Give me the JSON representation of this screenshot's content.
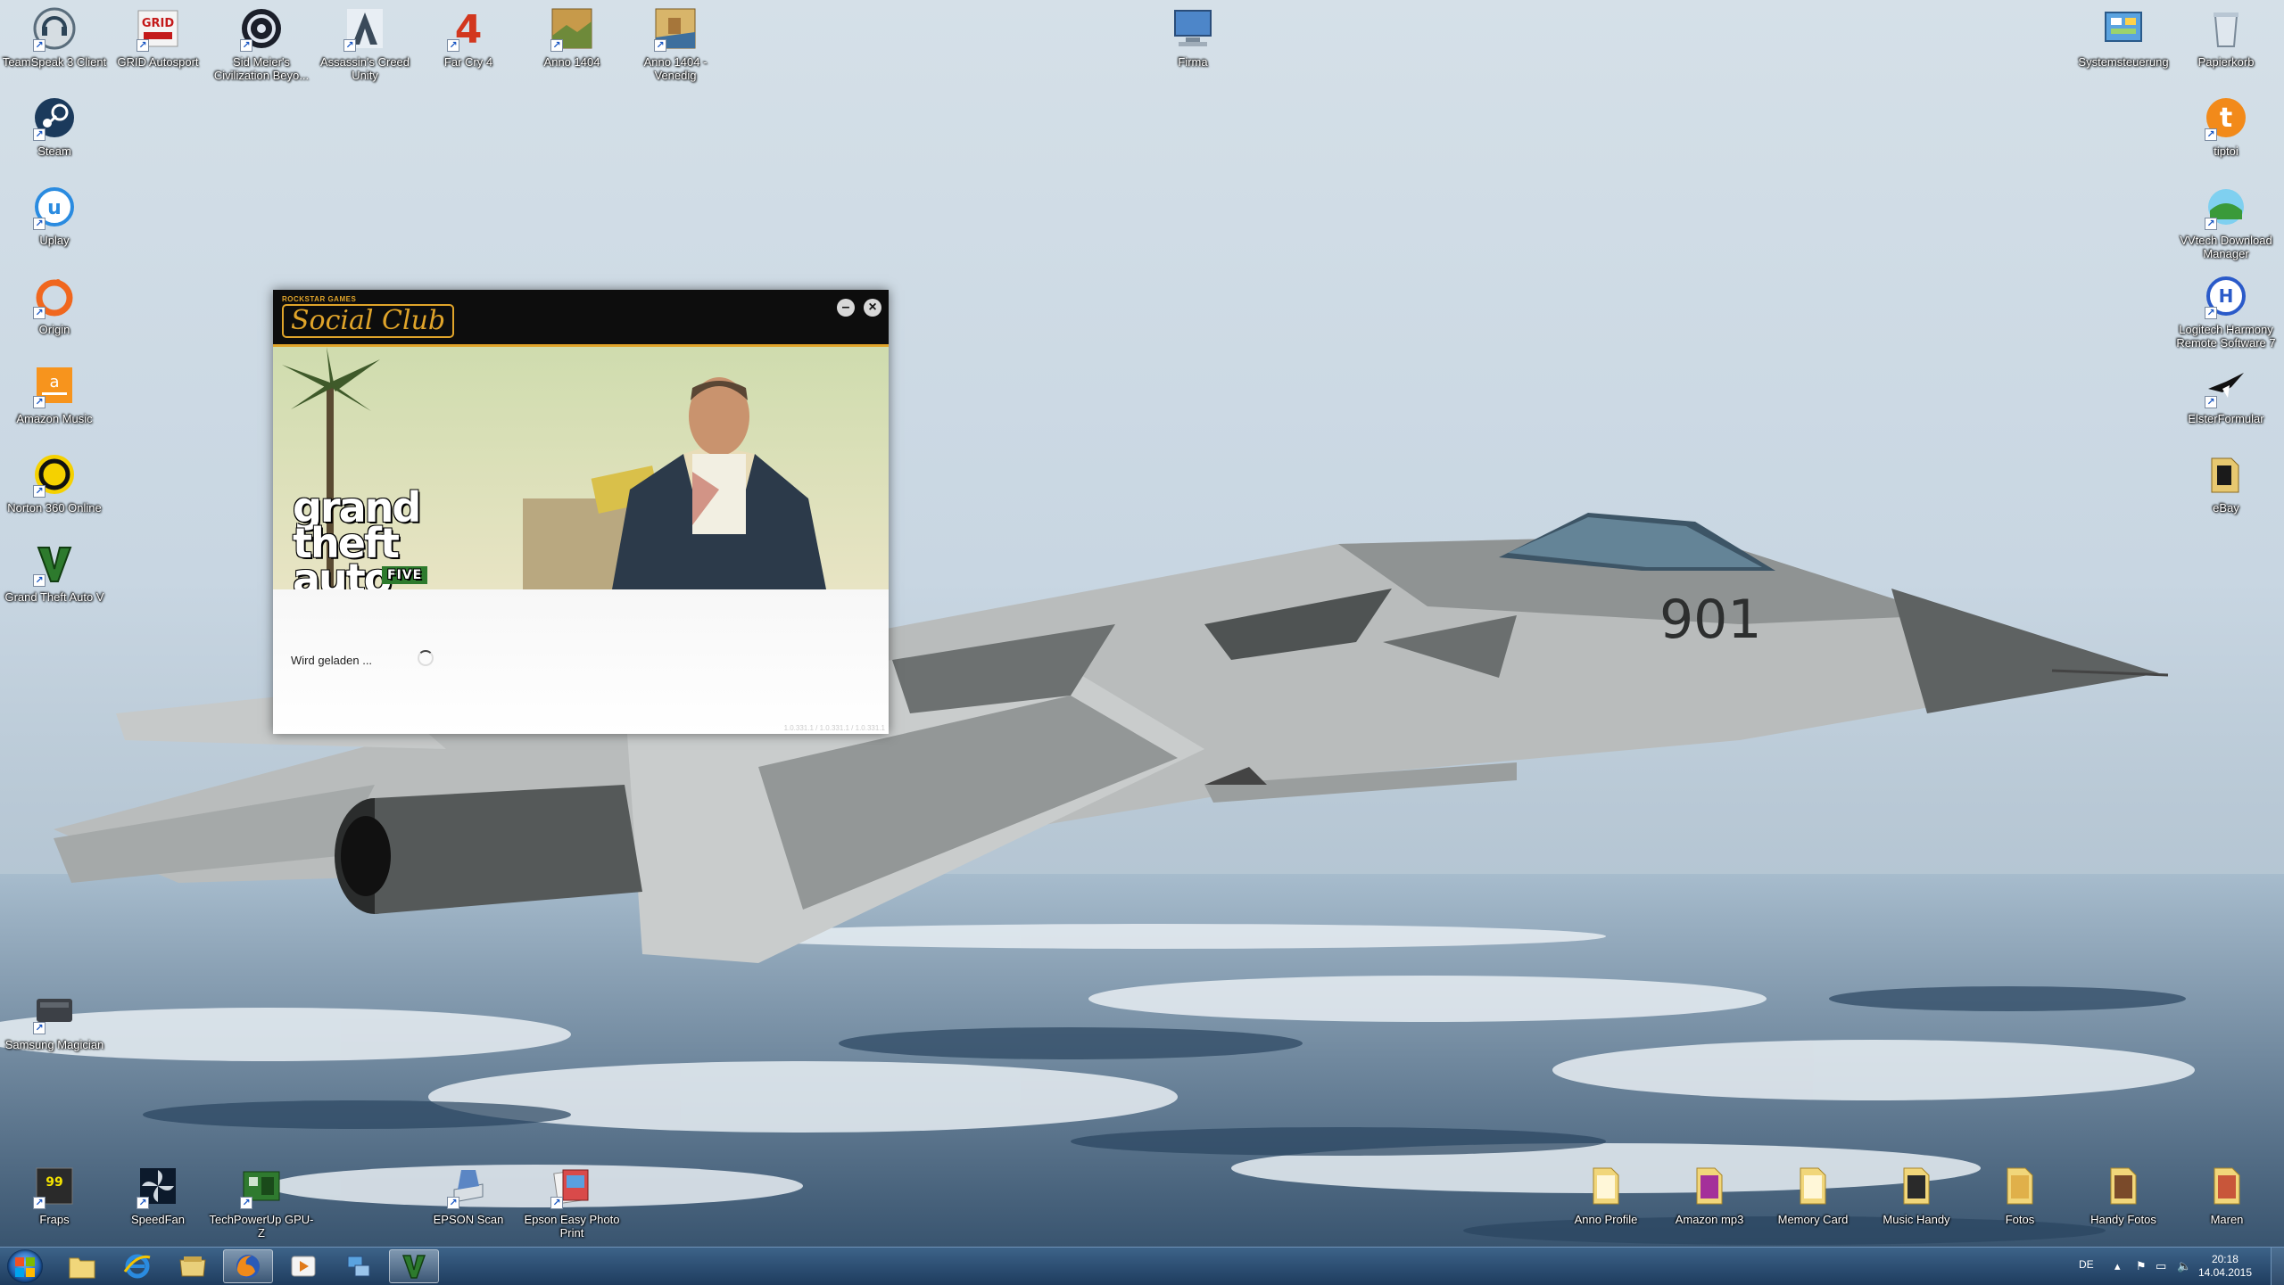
{
  "desktop": {
    "top_row": [
      {
        "label": "TeamSpeak 3 Client",
        "icon": "teamspeak-icon"
      },
      {
        "label": "GRID Autosport",
        "icon": "grid-autosport-icon"
      },
      {
        "label": "Sid Meier's Civilization Beyo...",
        "icon": "civilization-icon"
      },
      {
        "label": "Assassin's Creed Unity",
        "icon": "assassins-creed-icon"
      },
      {
        "label": "Far Cry 4",
        "icon": "far-cry-4-icon"
      },
      {
        "label": "Anno 1404",
        "icon": "anno-1404-icon"
      },
      {
        "label": "Anno 1404 - Venedig",
        "icon": "anno-1404-venedig-icon"
      },
      {
        "label": "Firma",
        "icon": "computer-icon"
      }
    ],
    "left_column": [
      {
        "label": "Steam",
        "icon": "steam-icon"
      },
      {
        "label": "Uplay",
        "icon": "uplay-icon"
      },
      {
        "label": "Origin",
        "icon": "origin-icon"
      },
      {
        "label": "Amazon Music",
        "icon": "amazon-music-icon"
      },
      {
        "label": "Norton 360 Online",
        "icon": "norton-icon"
      },
      {
        "label": "Grand Theft Auto V",
        "icon": "gta-v-icon"
      },
      {
        "label": "Samsung Magician",
        "icon": "samsung-magician-icon"
      }
    ],
    "right_column": [
      {
        "label": "Systemsteuerung",
        "icon": "control-panel-icon"
      },
      {
        "label": "Papierkorb",
        "icon": "recycle-bin-icon"
      },
      {
        "label": "tiptoi",
        "icon": "tiptoi-icon"
      },
      {
        "label": "VVtech Download Manager",
        "icon": "download-manager-icon"
      },
      {
        "label": "Logitech Harmony Remote Software 7",
        "icon": "logitech-harmony-icon"
      },
      {
        "label": "ElsterFormular",
        "icon": "elster-icon"
      },
      {
        "label": "eBay",
        "icon": "ebay-folder-icon"
      }
    ],
    "bottom_left": [
      {
        "label": "Fraps",
        "icon": "fraps-icon"
      },
      {
        "label": "SpeedFan",
        "icon": "speedfan-icon"
      },
      {
        "label": "TechPowerUp GPU-Z",
        "icon": "gpu-z-icon"
      },
      {
        "label": "EPSON Scan",
        "icon": "epson-scan-icon"
      },
      {
        "label": "Epson Easy Photo Print",
        "icon": "epson-photo-icon"
      }
    ],
    "bottom_right": [
      {
        "label": "Anno Profile",
        "icon": "folder-icon"
      },
      {
        "label": "Amazon mp3",
        "icon": "folder-icon"
      },
      {
        "label": "Memory Card",
        "icon": "folder-icon"
      },
      {
        "label": "Music Handy",
        "icon": "folder-icon"
      },
      {
        "label": "Fotos",
        "icon": "folder-icon"
      },
      {
        "label": "Handy Fotos",
        "icon": "folder-icon"
      },
      {
        "label": "Maren",
        "icon": "folder-icon"
      }
    ]
  },
  "social_club": {
    "brand_small": "ROCKSTAR GAMES",
    "brand": "Social Club",
    "game_logo_lines": [
      "grand",
      "theft",
      "auto"
    ],
    "game_logo_five": "FIVE",
    "loading_text": "Wird geladen ...",
    "version_text": "1.0.331.1 / 1.0.331.1 / 1.0.331.1"
  },
  "taskbar": {
    "buttons": [
      {
        "name": "explorer-taskbar-button",
        "icon": "folder-icon"
      },
      {
        "name": "internet-explorer-taskbar-button",
        "icon": "internet-explorer-icon"
      },
      {
        "name": "file-manager-taskbar-button",
        "icon": "file-manager-icon"
      },
      {
        "name": "firefox-taskbar-button",
        "icon": "firefox-icon"
      },
      {
        "name": "media-player-taskbar-button",
        "icon": "media-player-icon"
      },
      {
        "name": "network-taskbar-button",
        "icon": "network-icon"
      },
      {
        "name": "gta-v-taskbar-button",
        "icon": "gta-v-icon"
      }
    ],
    "tray": {
      "language": "DE",
      "time": "20:18",
      "date": "14.04.2015"
    }
  }
}
